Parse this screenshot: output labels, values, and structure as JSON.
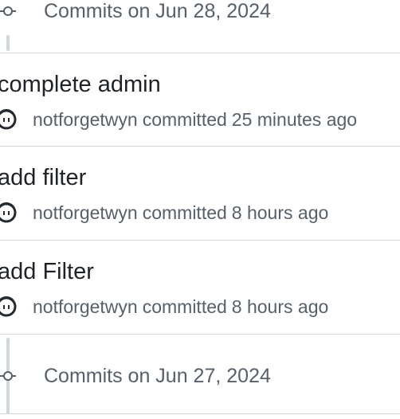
{
  "groups": [
    {
      "title": "Commits on Jun 28, 2024",
      "commits": [
        {
          "title": "complete admin",
          "author": "notforgetwyn",
          "action": "committed",
          "time": "25 minutes ago"
        },
        {
          "title": "add filter",
          "author": "notforgetwyn",
          "action": "committed",
          "time": "8 hours ago"
        },
        {
          "title": "add Filter",
          "author": "notforgetwyn",
          "action": "committed",
          "time": "8 hours ago"
        }
      ]
    },
    {
      "title": "Commits on Jun 27, 2024",
      "commits": []
    }
  ],
  "icons": {
    "group_marker": "git-commit-icon",
    "avatar": "avatar-icon"
  },
  "colors": {
    "text_primary": "#1f2328",
    "text_secondary": "#57606a",
    "border": "#d0d7de",
    "avatar_outline": "#24292f"
  }
}
